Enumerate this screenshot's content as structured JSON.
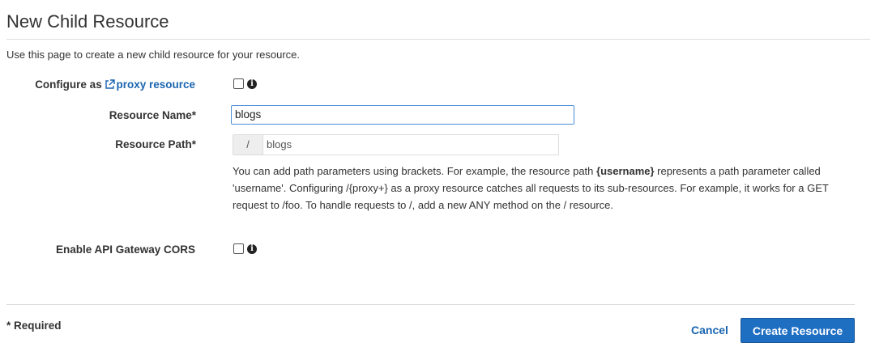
{
  "header": {
    "title": "New Child Resource",
    "intro": "Use this page to create a new child resource for your resource."
  },
  "form": {
    "proxy": {
      "label_prefix": "Configure as ",
      "link_text": "proxy resource",
      "checked": false
    },
    "resource_name": {
      "label": "Resource Name*",
      "value": "blogs"
    },
    "resource_path": {
      "label": "Resource Path*",
      "prefix": "/",
      "value": "blogs"
    },
    "help": {
      "part1": "You can add path parameters using brackets. For example, the resource path ",
      "bold": "{username}",
      "part2": " represents a path parameter called 'username'. Configuring /{proxy+} as a proxy resource catches all requests to its sub-resources. For example, it works for a GET request to /foo. To handle requests to /, add a new ANY method on the / resource."
    },
    "cors": {
      "label": "Enable API Gateway CORS",
      "checked": false
    }
  },
  "footer": {
    "required_note": "* Required",
    "cancel_label": "Cancel",
    "create_label": "Create Resource"
  },
  "colors": {
    "link": "#1a65b0",
    "primary_button": "#1e6ec2",
    "input_focus_border": "#4a8ed6"
  },
  "icons": {
    "external_link": "external-link-icon",
    "info": "info-icon"
  }
}
